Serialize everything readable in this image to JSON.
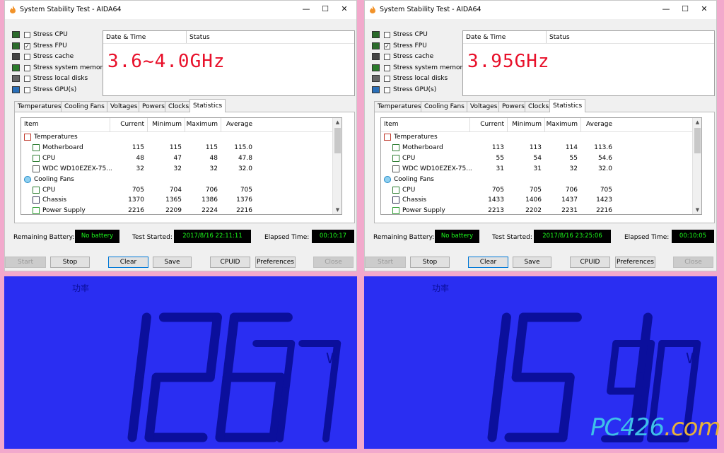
{
  "panels": [
    {
      "id": "left",
      "window_title": "System Stability Test - AIDA64",
      "overlay_text": "3.6~4.0GHz",
      "stress_options": [
        {
          "label": "Stress CPU",
          "checked": false,
          "icon": "cpu-chip-icon"
        },
        {
          "label": "Stress FPU",
          "checked": true,
          "icon": "fpu-chip-icon"
        },
        {
          "label": "Stress cache",
          "checked": false,
          "icon": "cache-icon"
        },
        {
          "label": "Stress system memory",
          "checked": false,
          "icon": "memory-icon"
        },
        {
          "label": "Stress local disks",
          "checked": false,
          "icon": "disk-icon"
        },
        {
          "label": "Stress GPU(s)",
          "checked": false,
          "icon": "monitor-icon"
        }
      ],
      "log_headers": [
        "Date & Time",
        "Status"
      ],
      "tabs": [
        "Temperatures",
        "Cooling Fans",
        "Voltages",
        "Powers",
        "Clocks",
        "Statistics"
      ],
      "active_tab": "Statistics",
      "table_headers": [
        "Item",
        "Current",
        "Minimum",
        "Maximum",
        "Average"
      ],
      "table_rows": [
        {
          "item": "Temperatures",
          "group": true,
          "icon": "thermometer-icon",
          "current": "",
          "minimum": "",
          "maximum": "",
          "average": ""
        },
        {
          "item": "Motherboard",
          "group": false,
          "icon": "motherboard-icon",
          "current": "115",
          "minimum": "115",
          "maximum": "115",
          "average": "115.0"
        },
        {
          "item": "CPU",
          "group": false,
          "icon": "cpu-icon",
          "current": "48",
          "minimum": "47",
          "maximum": "48",
          "average": "47.8"
        },
        {
          "item": "WDC WD10EZEX-75...",
          "group": false,
          "icon": "hdd-icon",
          "current": "32",
          "minimum": "32",
          "maximum": "32",
          "average": "32.0"
        },
        {
          "item": "Cooling Fans",
          "group": true,
          "icon": "fan-icon",
          "current": "",
          "minimum": "",
          "maximum": "",
          "average": ""
        },
        {
          "item": "CPU",
          "group": false,
          "icon": "cpu-icon",
          "current": "705",
          "minimum": "704",
          "maximum": "706",
          "average": "705"
        },
        {
          "item": "Chassis",
          "group": false,
          "icon": "chassis-icon",
          "current": "1370",
          "minimum": "1365",
          "maximum": "1386",
          "average": "1376"
        },
        {
          "item": "Power Supply",
          "group": false,
          "icon": "psu-icon",
          "current": "2216",
          "minimum": "2209",
          "maximum": "2224",
          "average": "2216"
        }
      ],
      "remaining_battery_label": "Remaining Battery:",
      "remaining_battery_value": "No battery",
      "test_started_label": "Test Started:",
      "test_started_value": "2017/8/16 22:11:11",
      "elapsed_label": "Elapsed Time:",
      "elapsed_value": "00:10:17",
      "buttons": {
        "start": "Start",
        "stop": "Stop",
        "clear": "Clear",
        "save": "Save",
        "cpuid": "CPUID",
        "preferences": "Preferences",
        "close": "Close"
      },
      "meter": {
        "label": "功率",
        "reading": "126.77",
        "unit": "W"
      }
    },
    {
      "id": "right",
      "window_title": "System Stability Test - AIDA64",
      "overlay_text": "3.95GHz",
      "stress_options": [
        {
          "label": "Stress CPU",
          "checked": false,
          "icon": "cpu-chip-icon"
        },
        {
          "label": "Stress FPU",
          "checked": true,
          "icon": "fpu-chip-icon"
        },
        {
          "label": "Stress cache",
          "checked": false,
          "icon": "cache-icon"
        },
        {
          "label": "Stress system memory",
          "checked": false,
          "icon": "memory-icon"
        },
        {
          "label": "Stress local disks",
          "checked": false,
          "icon": "disk-icon"
        },
        {
          "label": "Stress GPU(s)",
          "checked": false,
          "icon": "monitor-icon"
        }
      ],
      "log_headers": [
        "Date & Time",
        "Status"
      ],
      "tabs": [
        "Temperatures",
        "Cooling Fans",
        "Voltages",
        "Powers",
        "Clocks",
        "Statistics"
      ],
      "active_tab": "Statistics",
      "table_headers": [
        "Item",
        "Current",
        "Minimum",
        "Maximum",
        "Average"
      ],
      "table_rows": [
        {
          "item": "Temperatures",
          "group": true,
          "icon": "thermometer-icon",
          "current": "",
          "minimum": "",
          "maximum": "",
          "average": ""
        },
        {
          "item": "Motherboard",
          "group": false,
          "icon": "motherboard-icon",
          "current": "113",
          "minimum": "113",
          "maximum": "114",
          "average": "113.6"
        },
        {
          "item": "CPU",
          "group": false,
          "icon": "cpu-icon",
          "current": "55",
          "minimum": "54",
          "maximum": "55",
          "average": "54.6"
        },
        {
          "item": "WDC WD10EZEX-75...",
          "group": false,
          "icon": "hdd-icon",
          "current": "31",
          "minimum": "31",
          "maximum": "32",
          "average": "32.0"
        },
        {
          "item": "Cooling Fans",
          "group": true,
          "icon": "fan-icon",
          "current": "",
          "minimum": "",
          "maximum": "",
          "average": ""
        },
        {
          "item": "CPU",
          "group": false,
          "icon": "cpu-icon",
          "current": "705",
          "minimum": "705",
          "maximum": "706",
          "average": "705"
        },
        {
          "item": "Chassis",
          "group": false,
          "icon": "chassis-icon",
          "current": "1433",
          "minimum": "1406",
          "maximum": "1437",
          "average": "1423"
        },
        {
          "item": "Power Supply",
          "group": false,
          "icon": "psu-icon",
          "current": "2213",
          "minimum": "2202",
          "maximum": "2231",
          "average": "2216"
        }
      ],
      "remaining_battery_label": "Remaining Battery:",
      "remaining_battery_value": "No battery",
      "test_started_label": "Test Started:",
      "test_started_value": "2017/8/16 23:25:06",
      "elapsed_label": "Elapsed Time:",
      "elapsed_value": "00:10:05",
      "buttons": {
        "start": "Start",
        "stop": "Stop",
        "clear": "Clear",
        "save": "Save",
        "cpuid": "CPUID",
        "preferences": "Preferences",
        "close": "Close"
      },
      "meter": {
        "label": "功率",
        "reading": "151.90",
        "unit": "W"
      }
    }
  ],
  "watermark": {
    "text": "PC426",
    "suffix": ".com"
  },
  "colors": {
    "background": "#f2a9cc",
    "lcd": "#2a2ef2",
    "lcd_digits": "#0b0f9c",
    "overlay": "#e8102a",
    "status_value": "#1cff1c"
  }
}
